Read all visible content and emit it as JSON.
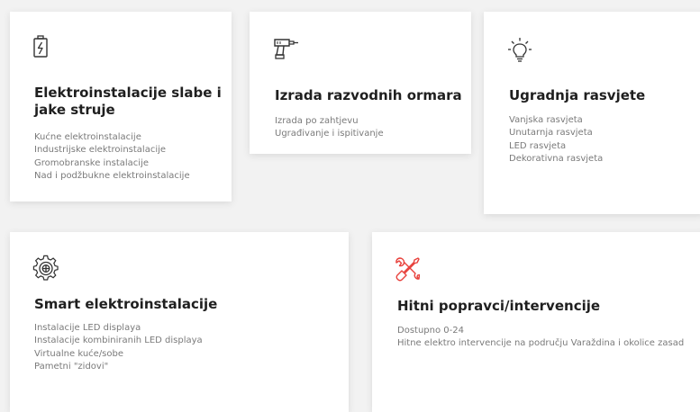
{
  "cards": [
    {
      "icon": "battery-charge-icon",
      "title": "Elektroinstalacije slabe i jake struje",
      "items": [
        "Kućne elektroinstalacije",
        "Industrijske elektroinstalacije",
        "Gromobranske instalacije",
        "Nad i podžbukne elektroinstalacije"
      ]
    },
    {
      "icon": "drill-icon",
      "title": "Izrada razvodnih ormara",
      "items": [
        "Izrada po zahtjevu",
        "Ugrađivanje i ispitivanje"
      ]
    },
    {
      "icon": "lightbulb-icon",
      "title": "Ugradnja rasvjete",
      "items": [
        "Vanjska rasvjeta",
        "Unutarnja rasvjeta",
        "LED rasvjeta",
        "Dekorativna rasvjeta"
      ]
    },
    {
      "icon": "smart-gear-icon",
      "title": "Smart elektroinstalacije",
      "items": [
        "Instalacije LED displaya",
        "Instalacije kombiniranih LED displaya",
        "Virtualne kuće/sobe",
        "Pametni \"zidovi\""
      ]
    },
    {
      "icon": "tools-icon",
      "title": "Hitni popravci/intervencije",
      "items": [
        "Dostupno 0-24",
        "Hitne elektro intervencije na području Varaždina i okolice zasad"
      ]
    }
  ],
  "colors": {
    "icon": "#333333",
    "accent": "#e8413c",
    "title": "#1f1f1f",
    "text": "#7a7a7a"
  }
}
